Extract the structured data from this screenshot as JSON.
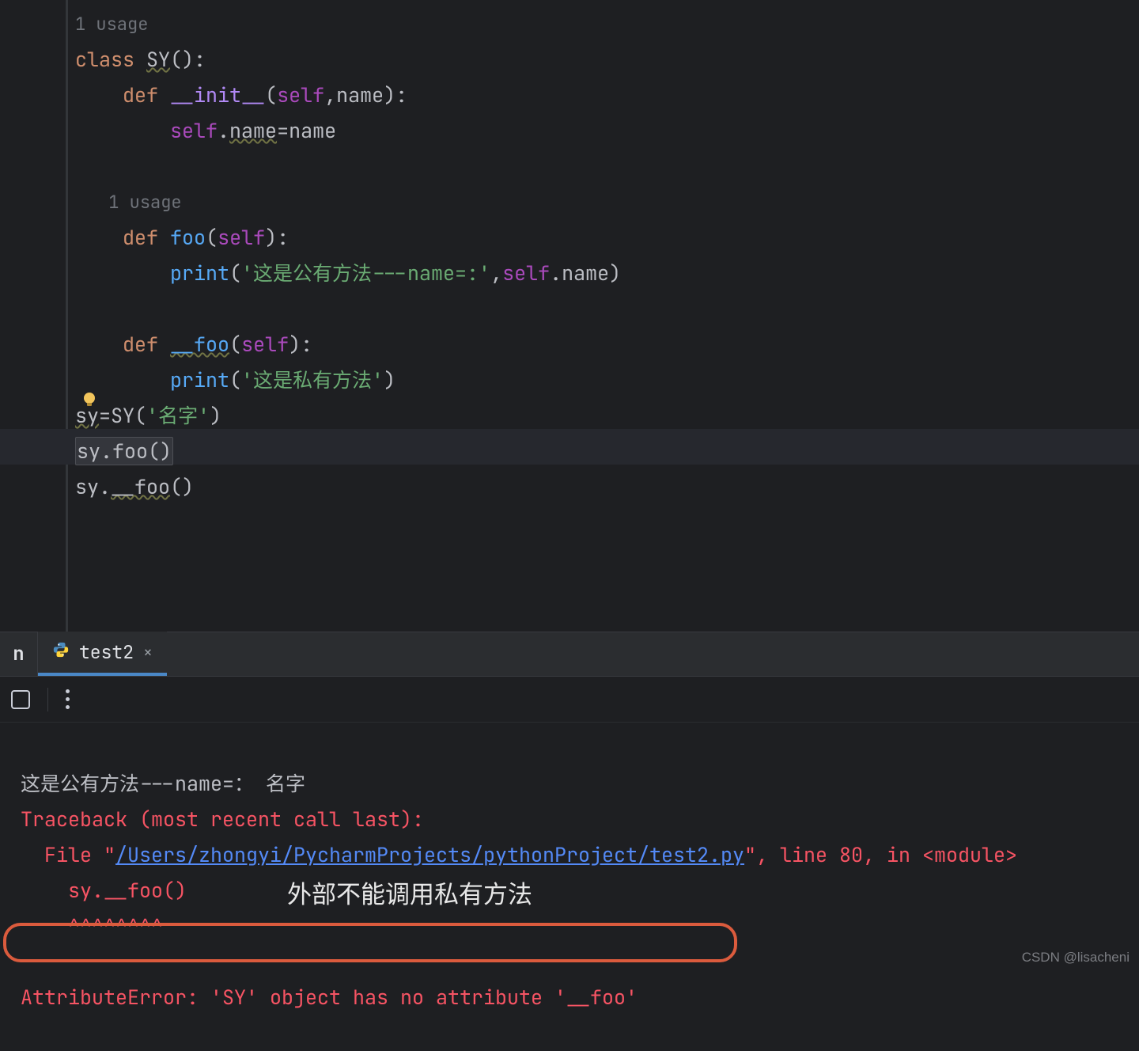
{
  "editor": {
    "hints": {
      "usage1": "1 usage",
      "usage2": "1 usage"
    },
    "code": {
      "l1_class": "class ",
      "l1_name": "SY",
      "l1_rest": "():",
      "l2_def": "def ",
      "l2_fn": "__init__",
      "l2_open": "(",
      "l2_self": "self",
      "l2_comma": ",",
      "l2_param": "name",
      "l2_close": "):",
      "l3_self": "self",
      "l3_dot": ".",
      "l3_attr": "name",
      "l3_eq": "=",
      "l3_val": "name",
      "l5_def": "def ",
      "l5_fn": "foo",
      "l5_open": "(",
      "l5_self": "self",
      "l5_close": "):",
      "l6_call": "print",
      "l6_open": "(",
      "l6_str": "'这是公有方法---name=:'",
      "l6_comma": ",",
      "l6_self": "self",
      "l6_dot": ".",
      "l6_attr": "name",
      "l6_close": ")",
      "l7_def": "def ",
      "l7_fn": "__foo",
      "l7_open": "(",
      "l7_self": "self",
      "l7_close": "):",
      "l8_call": "print",
      "l8_open": "(",
      "l8_str": "'这是私有方法'",
      "l8_close": ")",
      "l9_left": "sy",
      "l9_eq": "=",
      "l9_cls": "SY",
      "l9_open": "(",
      "l9_str": "'名字'",
      "l9_close": ")",
      "l10": "sy.foo()",
      "l11_a": "sy.",
      "l11_b": "__foo",
      "l11_c": "()"
    }
  },
  "run_tab": {
    "stub": "n",
    "title": "test2",
    "close": "×"
  },
  "console": {
    "out1": "这是公有方法---name=： 名字",
    "tb_head": "Traceback (most recent call last):",
    "tb_file_lead": "  File \"",
    "tb_file_path": "/Users/zhongyi/PycharmProjects/pythonProject/test2.py",
    "tb_file_tail": "\", line 80, in <module>",
    "tb_call": "    sy.__foo()",
    "tb_caret": "    ^^^^^^^^",
    "err_final": "AttributeError: 'SY' object has no attribute '__foo'"
  },
  "annotation": "外部不能调用私有方法",
  "watermark": "CSDN @lisacheni"
}
